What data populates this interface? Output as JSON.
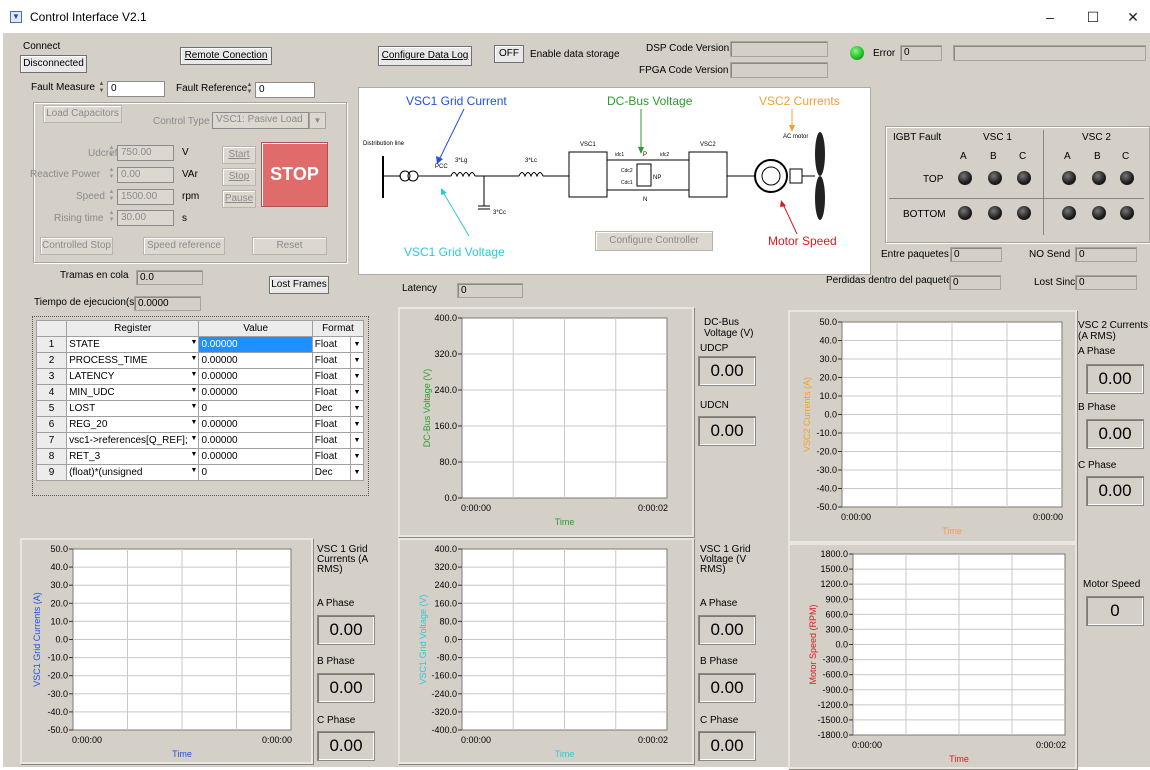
{
  "window": {
    "title": "Control Interface V2.1",
    "min": "–",
    "max": "☐",
    "close": "✕"
  },
  "connect": {
    "label": "Connect",
    "status": "Disconnected",
    "remote_button": "Remote Conection"
  },
  "fault": {
    "measure_label": "Fault Measure",
    "measure_value": "0",
    "reference_label": "Fault Reference",
    "reference_value": "0"
  },
  "control": {
    "load_capacitors": "Load Capacitors",
    "control_type_label": "Control Type",
    "control_type_value": "VSC1: Pasive Load",
    "udcref_label": "Udcref",
    "udcref_value": "750.00",
    "udcref_unit": "V",
    "reactive_label": "Reactive Power",
    "reactive_value": "0.00",
    "reactive_unit": "VAr",
    "speed_label": "Speed",
    "speed_value": "1500.00",
    "speed_unit": "rpm",
    "rising_label": "Rising time",
    "rising_value": "30.00",
    "rising_unit": "s",
    "start": "Start",
    "stop_small": "Stop",
    "pause": "Pause",
    "stop_big": "STOP",
    "controlled_stop": "Controlled Stop",
    "speed_reference": "Speed reference",
    "reset": "Reset"
  },
  "tramas": {
    "label": "Tramas en cola",
    "value": "0.0",
    "lost_frames": "Lost Frames",
    "tiempo_label": "Tiempo de ejecucion(s)",
    "tiempo_value": "0.0000"
  },
  "datalog": {
    "configure": "Configure Data Log",
    "off": "OFF",
    "enable": "Enable data storage"
  },
  "versions": {
    "dsp_label": "DSP Code Version",
    "fpga_label": "FPGA Code Version",
    "dsp_value": "",
    "fpga_value": ""
  },
  "error": {
    "label": "Error",
    "value": "0",
    "message": ""
  },
  "diagram": {
    "grid_current": "VSC1 Grid Current",
    "dc_bus": "DC-Bus Voltage",
    "vsc2_currents": "VSC2 Currents",
    "grid_voltage": "VSC1 Grid Voltage",
    "motor_speed": "Motor Speed",
    "configure_controller": "Configure Controller",
    "distribution_line": "Distribution line",
    "pcc": "PCC",
    "lg": "3*Lɡ",
    "lc": "3*Lc",
    "cc": "3*Cc",
    "vsc1": "VSC1",
    "vsc2": "VSC2",
    "idc1": "iɗc1",
    "idc2": "iɗc2",
    "ip": "ip",
    "cdc2": "Cdc2",
    "cdc1": "Cdc1",
    "np": "NP",
    "p": "P",
    "n": "N",
    "ac_motor": "AC motor"
  },
  "igbt": {
    "title": "IGBT Fault",
    "vsc1": "VSC 1",
    "vsc2": "VSC 2",
    "a": "A",
    "b": "B",
    "c": "C",
    "top": "TOP",
    "bottom": "BOTTOM"
  },
  "stats": {
    "entre_label": "Entre paquetes",
    "entre_value": "0",
    "nosend_label": "NO Send",
    "nosend_value": "0",
    "perdidas_label": "Perdidas dentro del paquete",
    "perdidas_value": "0",
    "lostsinc_label": "Lost Sinc",
    "lostsinc_value": "0",
    "latency_label": "Latency",
    "latency_value": "0"
  },
  "table": {
    "headers": [
      "Register",
      "Value",
      "Format"
    ],
    "rows": [
      {
        "n": "1",
        "reg": "STATE",
        "val": "0.00000",
        "fmt": "Float"
      },
      {
        "n": "2",
        "reg": "PROCESS_TIME",
        "val": "0.00000",
        "fmt": "Float"
      },
      {
        "n": "3",
        "reg": "LATENCY",
        "val": "0.00000",
        "fmt": "Float"
      },
      {
        "n": "4",
        "reg": "MIN_UDC",
        "val": "0.00000",
        "fmt": "Float"
      },
      {
        "n": "5",
        "reg": "LOST",
        "val": "0",
        "fmt": "Dec"
      },
      {
        "n": "6",
        "reg": "REG_20",
        "val": "0.00000",
        "fmt": "Float"
      },
      {
        "n": "7",
        "reg": "vsc1->references[Q_REF];",
        "val": "0.00000",
        "fmt": "Float"
      },
      {
        "n": "8",
        "reg": "RET_3",
        "val": "0.00000",
        "fmt": "Float"
      },
      {
        "n": "9",
        "reg": "(float)*(unsigned",
        "val": "0",
        "fmt": "Dec"
      }
    ]
  },
  "readouts": {
    "dcbus_title": "DC-Bus Voltage (V)",
    "udcp_label": "UDCP",
    "udcp_value": "0.00",
    "udcn_label": "UDCN",
    "udcn_value": "0.00",
    "vsc2_title": "VSC 2 Currents (A RMS)",
    "vsc2_a_label": "A Phase",
    "vsc2_a": "0.00",
    "vsc2_b_label": "B Phase",
    "vsc2_b": "0.00",
    "vsc2_c_label": "C Phase",
    "vsc2_c": "0.00",
    "gc_title": "VSC 1 Grid Currents (A RMS)",
    "gc_a_label": "A Phase",
    "gc_a": "0.00",
    "gc_b_label": "B Phase",
    "gc_b": "0.00",
    "gc_c_label": "C Phase",
    "gc_c": "0.00",
    "gv_title": "VSC 1 Grid Voltage (V RMS)",
    "gv_a_label": "A Phase",
    "gv_a": "0.00",
    "gv_b_label": "B Phase",
    "gv_b": "0.00",
    "gv_c_label": "C Phase",
    "gv_c": "0.00",
    "motor_title": "Motor Speed",
    "motor_value": "0"
  },
  "chart_data": [
    {
      "id": "dcbus",
      "type": "line",
      "ylabel": "DC-Bus Voltage (V)",
      "xlabel": "Time",
      "ylabel_color": "#2e9a2e",
      "xlabel_color": "#2e9a2e",
      "yticks": [
        "400.0",
        "320.0",
        "240.0",
        "160.0",
        "80.0",
        "0.0"
      ],
      "xticks": [
        "0:00:00",
        "0:00:02"
      ],
      "ylim": [
        0,
        400
      ],
      "series": []
    },
    {
      "id": "vsc2",
      "type": "line",
      "ylabel": "VSC2 Currents (A)",
      "xlabel": "Time",
      "ylabel_color": "#f0a030",
      "xlabel_color": "#f0a030",
      "yticks": [
        "50.0",
        "40.0",
        "30.0",
        "20.0",
        "10.0",
        "0.0",
        "-10.0",
        "-20.0",
        "-30.0",
        "-40.0",
        "-50.0"
      ],
      "xticks": [
        "0:00:00",
        "0:00:00"
      ],
      "ylim": [
        -50,
        50
      ],
      "series": []
    },
    {
      "id": "gridcur",
      "type": "line",
      "ylabel": "VSC1 Grid Currents (A)",
      "xlabel": "Time",
      "ylabel_color": "#2050e0",
      "xlabel_color": "#2050e0",
      "yticks": [
        "50.0",
        "40.0",
        "30.0",
        "20.0",
        "10.0",
        "0.0",
        "-10.0",
        "-20.0",
        "-30.0",
        "-40.0",
        "-50.0"
      ],
      "xticks": [
        "0:00:00",
        "0:00:00"
      ],
      "ylim": [
        -50,
        50
      ],
      "series": []
    },
    {
      "id": "gridvolt",
      "type": "line",
      "ylabel": "VSC1 Grid Voltage (V)",
      "xlabel": "Time",
      "ylabel_color": "#30c8d8",
      "xlabel_color": "#30c8d8",
      "yticks": [
        "400.0",
        "320.0",
        "240.0",
        "160.0",
        "80.0",
        "0.0",
        "-80.0",
        "-160.0",
        "-240.0",
        "-320.0",
        "-400.0"
      ],
      "xticks": [
        "0:00:00",
        "0:00:02"
      ],
      "ylim": [
        -400,
        400
      ],
      "series": []
    },
    {
      "id": "motor",
      "type": "line",
      "ylabel": "Motor Speed (RPM)",
      "xlabel": "Time",
      "ylabel_color": "#d02020",
      "xlabel_color": "#d02020",
      "yticks": [
        "1800.0",
        "1500.0",
        "1200.0",
        "900.0",
        "600.0",
        "300.0",
        "0.0",
        "-300.0",
        "-600.0",
        "-900.0",
        "-1200.0",
        "-1500.0",
        "-1800.0"
      ],
      "xticks": [
        "0:00:00",
        "0:00:02"
      ],
      "ylim": [
        -1800,
        1800
      ],
      "series": []
    }
  ],
  "colors": {
    "stop_button": "#e06b6b",
    "led_green": "#22c422",
    "led_off": "#1a1a1a",
    "selected_cell": "#1e90ff"
  }
}
